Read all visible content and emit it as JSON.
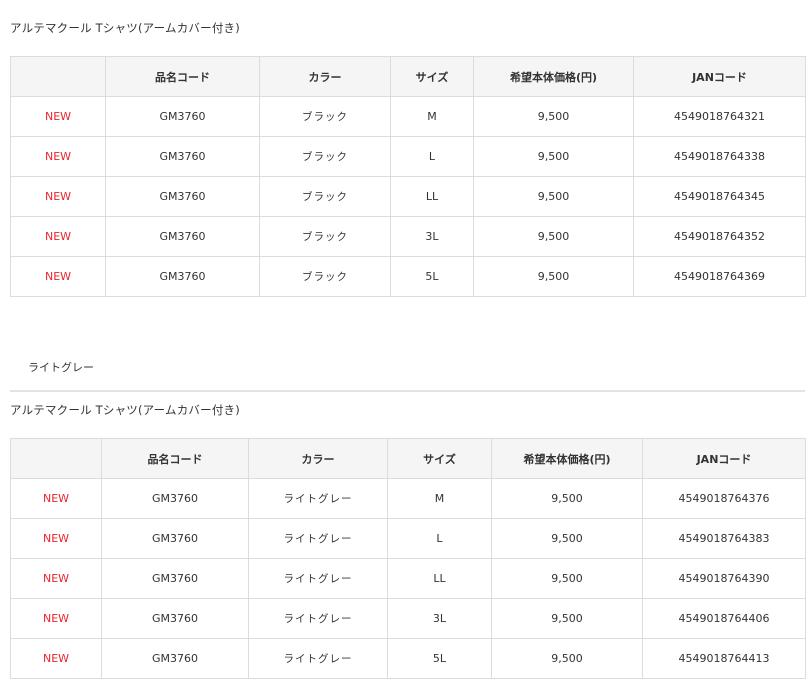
{
  "sections": [
    {
      "product_title": "アルテマクール Tシャツ(アームカバー付き)",
      "headers": [
        "",
        "品名コード",
        "カラー",
        "サイズ",
        "希望本体価格(円)",
        "JANコード"
      ],
      "rows": [
        {
          "badge": "NEW",
          "code": "GM3760",
          "color": "ブラック",
          "size": "M",
          "price": "9,500",
          "jan": "4549018764321"
        },
        {
          "badge": "NEW",
          "code": "GM3760",
          "color": "ブラック",
          "size": "L",
          "price": "9,500",
          "jan": "4549018764338"
        },
        {
          "badge": "NEW",
          "code": "GM3760",
          "color": "ブラック",
          "size": "LL",
          "price": "9,500",
          "jan": "4549018764345"
        },
        {
          "badge": "NEW",
          "code": "GM3760",
          "color": "ブラック",
          "size": "3L",
          "price": "9,500",
          "jan": "4549018764352"
        },
        {
          "badge": "NEW",
          "code": "GM3760",
          "color": "ブラック",
          "size": "5L",
          "price": "9,500",
          "jan": "4549018764369"
        }
      ]
    },
    {
      "color_label": "ライトグレー",
      "product_title": "アルテマクール Tシャツ(アームカバー付き)",
      "headers": [
        "",
        "品名コード",
        "カラー",
        "サイズ",
        "希望本体価格(円)",
        "JANコード"
      ],
      "rows": [
        {
          "badge": "NEW",
          "code": "GM3760",
          "color": "ライトグレー",
          "size": "M",
          "price": "9,500",
          "jan": "4549018764376"
        },
        {
          "badge": "NEW",
          "code": "GM3760",
          "color": "ライトグレー",
          "size": "L",
          "price": "9,500",
          "jan": "4549018764383"
        },
        {
          "badge": "NEW",
          "code": "GM3760",
          "color": "ライトグレー",
          "size": "LL",
          "price": "9,500",
          "jan": "4549018764390"
        },
        {
          "badge": "NEW",
          "code": "GM3760",
          "color": "ライトグレー",
          "size": "3L",
          "price": "9,500",
          "jan": "4549018764406"
        },
        {
          "badge": "NEW",
          "code": "GM3760",
          "color": "ライトグレー",
          "size": "5L",
          "price": "9,500",
          "jan": "4549018764413"
        }
      ]
    }
  ],
  "colors": {
    "new_badge": "#e8242c",
    "header_bg": "#f5f5f5",
    "border": "#dcdcdc",
    "text": "#333333"
  }
}
